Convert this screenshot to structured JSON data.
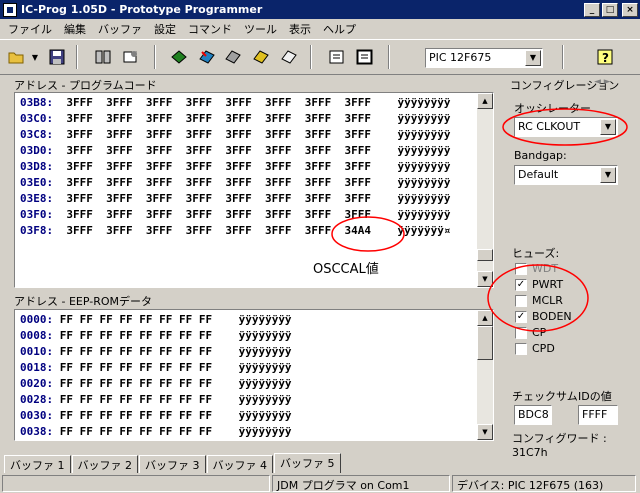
{
  "window": {
    "title": "IC-Prog 1.05D - Prototype Programmer",
    "min": "_",
    "max": "□",
    "close": "×"
  },
  "menu": [
    "ファイル",
    "編集",
    "バッファ",
    "設定",
    "コマンド",
    "ツール",
    "表示",
    "ヘルプ"
  ],
  "toolbar": {
    "device": "PIC 12F675"
  },
  "program_panel": {
    "label": "アドレス - プログラムコード",
    "rows": [
      {
        "addr": "03B8:",
        "data": "3FFF  3FFF  3FFF  3FFF  3FFF  3FFF  3FFF  3FFF",
        "ascii": "ÿÿÿÿÿÿÿÿ"
      },
      {
        "addr": "03C0:",
        "data": "3FFF  3FFF  3FFF  3FFF  3FFF  3FFF  3FFF  3FFF",
        "ascii": "ÿÿÿÿÿÿÿÿ"
      },
      {
        "addr": "03C8:",
        "data": "3FFF  3FFF  3FFF  3FFF  3FFF  3FFF  3FFF  3FFF",
        "ascii": "ÿÿÿÿÿÿÿÿ"
      },
      {
        "addr": "03D0:",
        "data": "3FFF  3FFF  3FFF  3FFF  3FFF  3FFF  3FFF  3FFF",
        "ascii": "ÿÿÿÿÿÿÿÿ"
      },
      {
        "addr": "03D8:",
        "data": "3FFF  3FFF  3FFF  3FFF  3FFF  3FFF  3FFF  3FFF",
        "ascii": "ÿÿÿÿÿÿÿÿ"
      },
      {
        "addr": "03E0:",
        "data": "3FFF  3FFF  3FFF  3FFF  3FFF  3FFF  3FFF  3FFF",
        "ascii": "ÿÿÿÿÿÿÿÿ"
      },
      {
        "addr": "03E8:",
        "data": "3FFF  3FFF  3FFF  3FFF  3FFF  3FFF  3FFF  3FFF",
        "ascii": "ÿÿÿÿÿÿÿÿ"
      },
      {
        "addr": "03F0:",
        "data": "3FFF  3FFF  3FFF  3FFF  3FFF  3FFF  3FFF  3FFF",
        "ascii": "ÿÿÿÿÿÿÿÿ"
      },
      {
        "addr": "03F8:",
        "data": "3FFF  3FFF  3FFF  3FFF  3FFF  3FFF  3FFF  34A4",
        "ascii": "ÿÿÿÿÿÿÿ¤"
      }
    ],
    "annotation": "OSCCAL値"
  },
  "eeprom_panel": {
    "label": "アドレス - EEP-ROMデータ",
    "rows": [
      {
        "addr": "0000:",
        "data": "FF FF FF FF FF FF FF FF",
        "ascii": "ÿÿÿÿÿÿÿÿ"
      },
      {
        "addr": "0008:",
        "data": "FF FF FF FF FF FF FF FF",
        "ascii": "ÿÿÿÿÿÿÿÿ"
      },
      {
        "addr": "0010:",
        "data": "FF FF FF FF FF FF FF FF",
        "ascii": "ÿÿÿÿÿÿÿÿ"
      },
      {
        "addr": "0018:",
        "data": "FF FF FF FF FF FF FF FF",
        "ascii": "ÿÿÿÿÿÿÿÿ"
      },
      {
        "addr": "0020:",
        "data": "FF FF FF FF FF FF FF FF",
        "ascii": "ÿÿÿÿÿÿÿÿ"
      },
      {
        "addr": "0028:",
        "data": "FF FF FF FF FF FF FF FF",
        "ascii": "ÿÿÿÿÿÿÿÿ"
      },
      {
        "addr": "0030:",
        "data": "FF FF FF FF FF FF FF FF",
        "ascii": "ÿÿÿÿÿÿÿÿ"
      },
      {
        "addr": "0038:",
        "data": "FF FF FF FF FF FF FF FF",
        "ascii": "ÿÿÿÿÿÿÿÿ"
      }
    ]
  },
  "config": {
    "label": "コンフィグレーション",
    "oscillator_label": "オッシレーター",
    "oscillator_value": "RC CLKOUT",
    "bandgap_label": "Bandgap:",
    "bandgap_value": "Default",
    "fuses_label": "ヒューズ:",
    "fuses": [
      {
        "name": "WDT",
        "checked": false
      },
      {
        "name": "PWRT",
        "checked": true
      },
      {
        "name": "MCLR",
        "checked": false
      },
      {
        "name": "BODEN",
        "checked": true
      },
      {
        "name": "CP",
        "checked": false
      },
      {
        "name": "CPD",
        "checked": false
      }
    ],
    "checksum_label": "チェックサム",
    "checksum_value": "BDC8",
    "id_label": "IDの値",
    "id_value": "FFFF",
    "config_word": "コンフィグワード : 31C7h"
  },
  "tabs": [
    "バッファ 1",
    "バッファ 2",
    "バッファ 3",
    "バッファ 4",
    "バッファ 5"
  ],
  "status": {
    "interface": "JDM プログラマ on Com1",
    "device": "デバイス: PIC 12F675  (163)"
  },
  "colors": {
    "annotation": "#ff0000",
    "title_bg": "#0a246a",
    "address": "#000080"
  }
}
